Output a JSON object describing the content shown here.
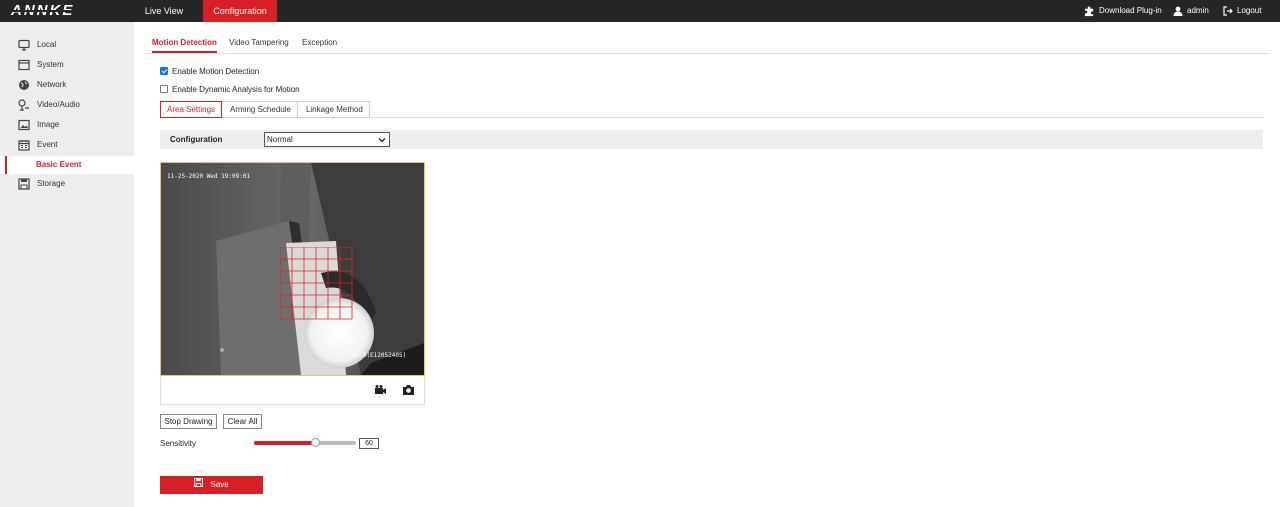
{
  "brand": {
    "logo_text": "ANNKE"
  },
  "topnav": {
    "live_view": "Live View",
    "configuration": "Configuration",
    "download_plugin": "Download Plug-in",
    "user": "admin",
    "logout": "Logout"
  },
  "sidebar": {
    "items": [
      {
        "label": "Local",
        "icon": "monitor-icon"
      },
      {
        "label": "System",
        "icon": "system-icon"
      },
      {
        "label": "Network",
        "icon": "globe-icon"
      },
      {
        "label": "Video/Audio",
        "icon": "mic-icon"
      },
      {
        "label": "Image",
        "icon": "image-icon"
      },
      {
        "label": "Event",
        "icon": "calendar-icon"
      },
      {
        "label": "Storage",
        "icon": "save-icon"
      }
    ],
    "selected_sub": "Basic Event"
  },
  "tabs": {
    "motion_detection": "Motion Detection",
    "video_tampering": "Video Tampering",
    "exception": "Exception",
    "active": "Motion Detection"
  },
  "options": {
    "enable_motion": {
      "label": "Enable Motion Detection",
      "checked": true
    },
    "enable_dynamic": {
      "label": "Enable Dynamic Analysis for Motion",
      "checked": false
    }
  },
  "steps": {
    "area_settings": "Area Settings",
    "arming_schedule": "Arming Schedule",
    "linkage_method": "Linkage Method"
  },
  "config": {
    "label": "Configuration",
    "value": "Normal"
  },
  "video": {
    "timestamp": "11-25-2020 Wed 19:09:01",
    "camera_name": "IS10(E12052405)"
  },
  "buttons": {
    "stop_drawing": "Stop Drawing",
    "clear_all": "Clear All",
    "save": "Save"
  },
  "sensitivity": {
    "label": "Sensitivity",
    "value": "60",
    "level_fraction": 0.6
  },
  "colors": {
    "accent": "#d91f26",
    "topbar": "#262626",
    "sidebar": "#ededed"
  }
}
